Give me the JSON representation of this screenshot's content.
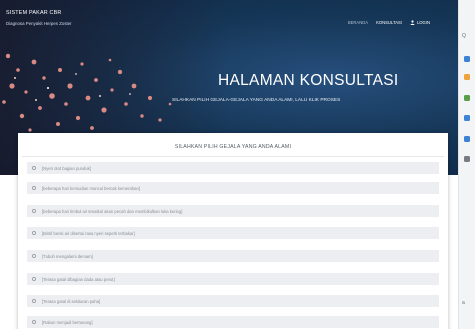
{
  "navbar": {
    "brand_title": "SISTEM PAKAR CBR",
    "brand_subtitle": "Diagnosa Penyakit Herpes Zoster",
    "links": [
      {
        "label": "BERANDA"
      },
      {
        "label": "KONSULTASI"
      }
    ],
    "login_label": "LOGIN"
  },
  "hero": {
    "title": "HALAMAN KONSULTASI",
    "subtitle": "SILAHKAN PILIH GEJALA-GEJALA YANG ANDA ALAMI, LALU KLIK PROSES"
  },
  "card": {
    "title": "SILAHKAN PILIH GEJALA YANG ANDA ALAMI",
    "options": [
      {
        "label": "[Nyeri otot bagian punduk]"
      },
      {
        "label": "[beberapa hari kemudian muncul bercak kemerahan]"
      },
      {
        "label": "[beberapa hari timbul air tenatkul akan pecah dan membikulkan luka kering]"
      },
      {
        "label": "[Bintil berisi air disertai rasa nyeri seperti terbakar]"
      },
      {
        "label": "[Tubuh mengalami demam]"
      },
      {
        "label": "[Terasa gatal dibagian dada atau perut]"
      },
      {
        "label": "[Terasa gatal di sekitaran paha]"
      },
      {
        "label": "[Rabun menjadi bertunang]"
      }
    ]
  },
  "side_strip": {
    "texts": [
      {
        "label": "Q"
      },
      {
        "label": "a"
      }
    ],
    "icon_colors": [
      "#3c82d7",
      "#f0a23c",
      "#5a9e4b",
      "#3c82d7",
      "#3c82d7",
      "#777b82"
    ]
  },
  "colors": {
    "hero_dark": "#0c2340",
    "hero_mid": "#27507e",
    "option_bg": "#eceef1",
    "salt": "#d98a84"
  }
}
